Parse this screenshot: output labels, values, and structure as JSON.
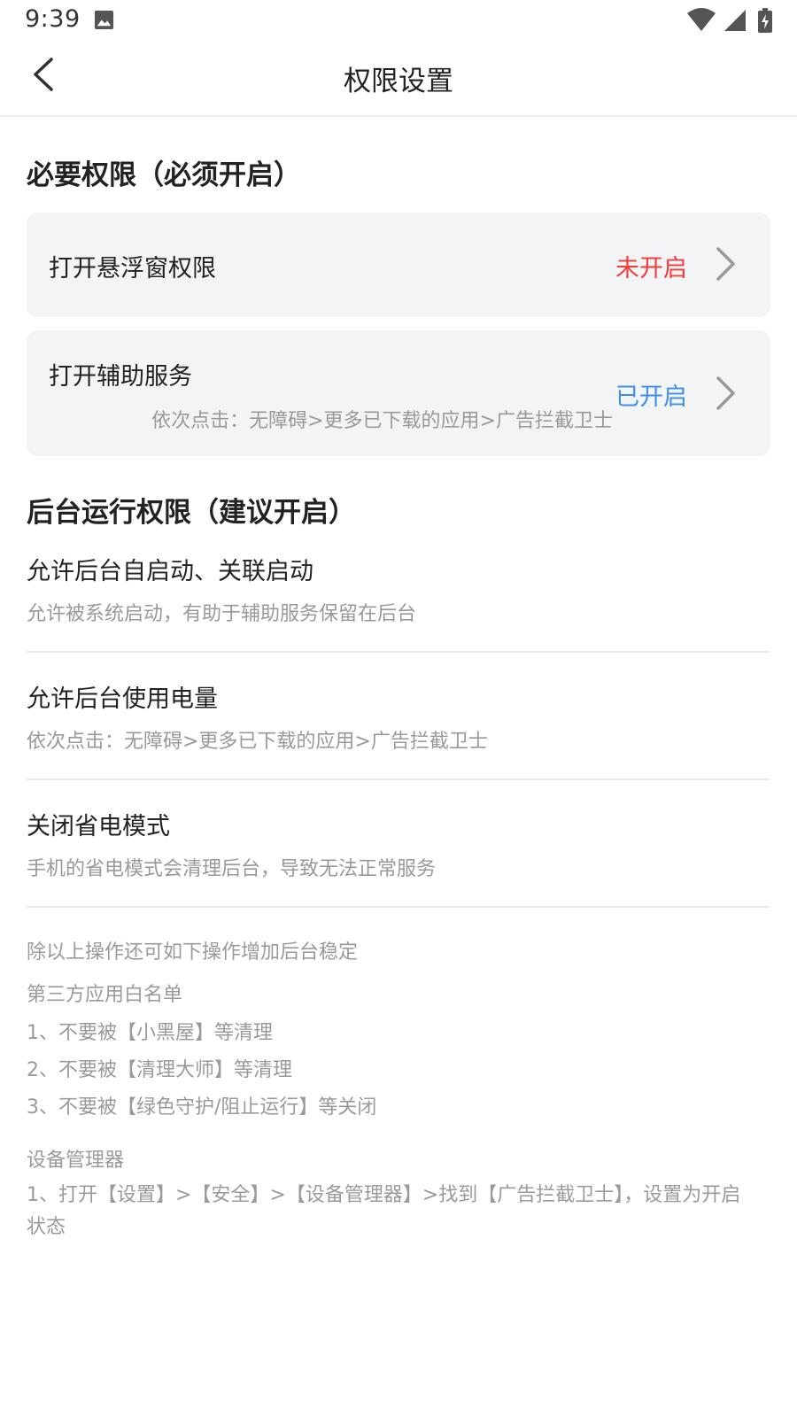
{
  "status_bar": {
    "time": "9:39",
    "icons": [
      "image-icon",
      "wifi-icon",
      "cell-signal-icon",
      "battery-charging-icon"
    ]
  },
  "header": {
    "title": "权限设置",
    "back_icon": "chevron-left-icon"
  },
  "required_section": {
    "title": "必要权限（必须开启）",
    "items": [
      {
        "label": "打开悬浮窗权限",
        "status": "未开启",
        "status_color": "#f43b3b"
      },
      {
        "label": "打开辅助服务",
        "hint": "依次点击：无障碍>更多已下载的应用>广告拦截卫士",
        "status": "已开启",
        "status_color": "#3f8ee8"
      }
    ]
  },
  "background_section": {
    "title": "后台运行权限（建议开启）",
    "items": [
      {
        "title": "允许后台自启动、关联启动",
        "desc": "允许被系统启动，有助于辅助服务保留在后台"
      },
      {
        "title": "允许后台使用电量",
        "desc": "依次点击：无障碍>更多已下载的应用>广告拦截卫士"
      },
      {
        "title": "关闭省电模式",
        "desc": "手机的省电模式会清理后台，导致无法正常服务"
      }
    ]
  },
  "tips": {
    "intro": "除以上操作还可如下操作增加后台稳定",
    "whitelist_title": "第三方应用白名单",
    "whitelist_items": [
      "1、不要被【小黑屋】等清理",
      "2、不要被【清理大师】等清理",
      "3、不要被【绿色守护/阻止运行】等关闭"
    ],
    "device_admin_title": "设备管理器",
    "device_admin_items": [
      "1、打开【设置】>【安全】>【设备管理器】>找到【广告拦截卫士】，设置为开启状态"
    ]
  }
}
